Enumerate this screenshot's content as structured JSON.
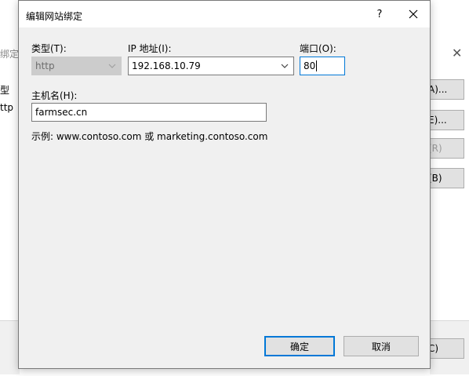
{
  "background": {
    "title": "绑定",
    "list_header": "型",
    "list_item": "ttp",
    "buttons": [
      "A)...",
      "E)...",
      "(R)",
      "(B)",
      "C)"
    ]
  },
  "dialog": {
    "title": "编辑网站绑定",
    "help_label": "?",
    "type": {
      "label": "类型(T):",
      "value": "http"
    },
    "ip": {
      "label": "IP 地址(I):",
      "value": "192.168.10.79"
    },
    "port": {
      "label": "端口(O):",
      "value": "80"
    },
    "hostname": {
      "label": "主机名(H):",
      "value": "farmsec.cn"
    },
    "example": "示例: www.contoso.com 或 marketing.contoso.com",
    "ok_label": "确定",
    "cancel_label": "取消"
  },
  "colors": {
    "accent": "#0078d7",
    "dialog_bg": "#f0f0f0",
    "disabled_field": "#cccccc"
  }
}
